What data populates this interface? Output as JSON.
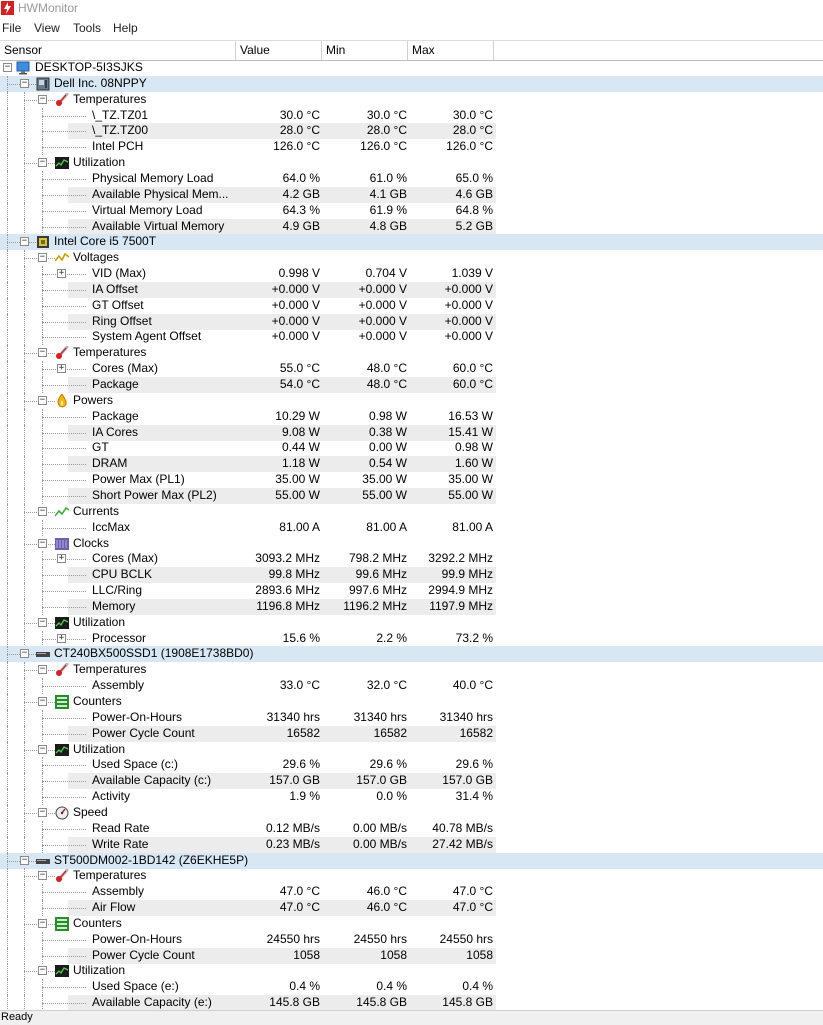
{
  "app": {
    "title": "HWMonitor"
  },
  "menu": [
    "File",
    "View",
    "Tools",
    "Help"
  ],
  "columns": [
    "Sensor",
    "Value",
    "Min",
    "Max"
  ],
  "status": "Ready",
  "rows": [
    {
      "level": 0,
      "type": "root",
      "icon": "computer-icon",
      "label": "DESKTOP-5I3SJKS"
    },
    {
      "level": 1,
      "type": "device",
      "icon": "motherboard-icon",
      "label": "Dell Inc. 08NPPY",
      "hl": true
    },
    {
      "level": 2,
      "type": "group",
      "icon": "thermometer-icon",
      "label": "Temperatures"
    },
    {
      "level": 3,
      "type": "sensor",
      "label": "\\_TZ.TZ01",
      "value": "30.0 °C",
      "min": "30.0 °C",
      "max": "30.0 °C"
    },
    {
      "level": 3,
      "type": "sensor",
      "label": "\\_TZ.TZ00",
      "value": "28.0 °C",
      "min": "28.0 °C",
      "max": "28.0 °C"
    },
    {
      "level": 3,
      "type": "sensor",
      "label": "Intel PCH",
      "value": "126.0 °C",
      "min": "126.0 °C",
      "max": "126.0 °C"
    },
    {
      "level": 2,
      "type": "group",
      "icon": "utilization-icon",
      "label": "Utilization"
    },
    {
      "level": 3,
      "type": "sensor",
      "label": "Physical Memory Load",
      "value": "64.0 %",
      "min": "61.0 %",
      "max": "65.0 %"
    },
    {
      "level": 3,
      "type": "sensor",
      "label": "Available Physical Mem...",
      "value": "4.2 GB",
      "min": "4.1 GB",
      "max": "4.6 GB"
    },
    {
      "level": 3,
      "type": "sensor",
      "label": "Virtual Memory Load",
      "value": "64.3 %",
      "min": "61.9 %",
      "max": "64.8 %"
    },
    {
      "level": 3,
      "type": "sensor",
      "label": "Available Virtual Memory",
      "value": "4.9 GB",
      "min": "4.8 GB",
      "max": "5.2 GB"
    },
    {
      "level": 1,
      "type": "device",
      "icon": "cpu-icon",
      "label": "Intel Core i5 7500T",
      "hl": true
    },
    {
      "level": 2,
      "type": "group",
      "icon": "voltage-icon",
      "label": "Voltages"
    },
    {
      "level": 3,
      "type": "sensor",
      "label": "VID (Max)",
      "value": "0.998 V",
      "min": "0.704 V",
      "max": "1.039 V",
      "exp": true
    },
    {
      "level": 3,
      "type": "sensor",
      "label": "IA Offset",
      "value": "+0.000 V",
      "min": "+0.000 V",
      "max": "+0.000 V"
    },
    {
      "level": 3,
      "type": "sensor",
      "label": "GT Offset",
      "value": "+0.000 V",
      "min": "+0.000 V",
      "max": "+0.000 V"
    },
    {
      "level": 3,
      "type": "sensor",
      "label": "Ring Offset",
      "value": "+0.000 V",
      "min": "+0.000 V",
      "max": "+0.000 V"
    },
    {
      "level": 3,
      "type": "sensor",
      "label": "System Agent Offset",
      "value": "+0.000 V",
      "min": "+0.000 V",
      "max": "+0.000 V"
    },
    {
      "level": 2,
      "type": "group",
      "icon": "thermometer-icon",
      "label": "Temperatures"
    },
    {
      "level": 3,
      "type": "sensor",
      "label": "Cores (Max)",
      "value": "55.0 °C",
      "min": "48.0 °C",
      "max": "60.0 °C",
      "exp": true
    },
    {
      "level": 3,
      "type": "sensor",
      "label": "Package",
      "value": "54.0 °C",
      "min": "48.0 °C",
      "max": "60.0 °C"
    },
    {
      "level": 2,
      "type": "group",
      "icon": "power-icon",
      "label": "Powers"
    },
    {
      "level": 3,
      "type": "sensor",
      "label": "Package",
      "value": "10.29 W",
      "min": "0.98 W",
      "max": "16.53 W"
    },
    {
      "level": 3,
      "type": "sensor",
      "label": "IA Cores",
      "value": "9.08 W",
      "min": "0.38 W",
      "max": "15.41 W"
    },
    {
      "level": 3,
      "type": "sensor",
      "label": "GT",
      "value": "0.44 W",
      "min": "0.00 W",
      "max": "0.98 W"
    },
    {
      "level": 3,
      "type": "sensor",
      "label": "DRAM",
      "value": "1.18 W",
      "min": "0.54 W",
      "max": "1.60 W"
    },
    {
      "level": 3,
      "type": "sensor",
      "label": "Power Max (PL1)",
      "value": "35.00 W",
      "min": "35.00 W",
      "max": "35.00 W"
    },
    {
      "level": 3,
      "type": "sensor",
      "label": "Short Power Max (PL2)",
      "value": "55.00 W",
      "min": "55.00 W",
      "max": "55.00 W"
    },
    {
      "level": 2,
      "type": "group",
      "icon": "current-icon",
      "label": "Currents"
    },
    {
      "level": 3,
      "type": "sensor",
      "label": "IccMax",
      "value": "81.00 A",
      "min": "81.00 A",
      "max": "81.00 A"
    },
    {
      "level": 2,
      "type": "group",
      "icon": "clock-icon",
      "label": "Clocks"
    },
    {
      "level": 3,
      "type": "sensor",
      "label": "Cores (Max)",
      "value": "3093.2 MHz",
      "min": "798.2 MHz",
      "max": "3292.2 MHz",
      "exp": true
    },
    {
      "level": 3,
      "type": "sensor",
      "label": "CPU BCLK",
      "value": "99.8 MHz",
      "min": "99.6 MHz",
      "max": "99.9 MHz"
    },
    {
      "level": 3,
      "type": "sensor",
      "label": "LLC/Ring",
      "value": "2893.6 MHz",
      "min": "997.6 MHz",
      "max": "2994.9 MHz"
    },
    {
      "level": 3,
      "type": "sensor",
      "label": "Memory",
      "value": "1196.8 MHz",
      "min": "1196.2 MHz",
      "max": "1197.9 MHz"
    },
    {
      "level": 2,
      "type": "group",
      "icon": "utilization-icon",
      "label": "Utilization"
    },
    {
      "level": 3,
      "type": "sensor",
      "label": "Processor",
      "value": "15.6 %",
      "min": "2.2 %",
      "max": "73.2 %",
      "exp": true
    },
    {
      "level": 1,
      "type": "device",
      "icon": "drive-icon",
      "label": "CT240BX500SSD1 (1908E1738BD0)",
      "hl": true
    },
    {
      "level": 2,
      "type": "group",
      "icon": "thermometer-icon",
      "label": "Temperatures"
    },
    {
      "level": 3,
      "type": "sensor",
      "label": "Assembly",
      "value": "33.0 °C",
      "min": "32.0 °C",
      "max": "40.0 °C"
    },
    {
      "level": 2,
      "type": "group",
      "icon": "counter-icon",
      "label": "Counters"
    },
    {
      "level": 3,
      "type": "sensor",
      "label": "Power-On-Hours",
      "value": "31340 hrs",
      "min": "31340 hrs",
      "max": "31340 hrs"
    },
    {
      "level": 3,
      "type": "sensor",
      "label": "Power Cycle Count",
      "value": "16582",
      "min": "16582",
      "max": "16582"
    },
    {
      "level": 2,
      "type": "group",
      "icon": "utilization-icon",
      "label": "Utilization"
    },
    {
      "level": 3,
      "type": "sensor",
      "label": "Used Space (c:)",
      "value": "29.6 %",
      "min": "29.6 %",
      "max": "29.6 %"
    },
    {
      "level": 3,
      "type": "sensor",
      "label": "Available Capacity (c:)",
      "value": "157.0 GB",
      "min": "157.0 GB",
      "max": "157.0 GB"
    },
    {
      "level": 3,
      "type": "sensor",
      "label": "Activity",
      "value": "1.9 %",
      "min": "0.0 %",
      "max": "31.4 %"
    },
    {
      "level": 2,
      "type": "group",
      "icon": "speed-icon",
      "label": "Speed"
    },
    {
      "level": 3,
      "type": "sensor",
      "label": "Read Rate",
      "value": "0.12 MB/s",
      "min": "0.00 MB/s",
      "max": "40.78 MB/s"
    },
    {
      "level": 3,
      "type": "sensor",
      "label": "Write Rate",
      "value": "0.23 MB/s",
      "min": "0.00 MB/s",
      "max": "27.42 MB/s"
    },
    {
      "level": 1,
      "type": "device",
      "icon": "drive-icon",
      "label": "ST500DM002-1BD142 (Z6EKHE5P)",
      "hl": true
    },
    {
      "level": 2,
      "type": "group",
      "icon": "thermometer-icon",
      "label": "Temperatures"
    },
    {
      "level": 3,
      "type": "sensor",
      "label": "Assembly",
      "value": "47.0 °C",
      "min": "46.0 °C",
      "max": "47.0 °C"
    },
    {
      "level": 3,
      "type": "sensor",
      "label": "Air Flow",
      "value": "47.0 °C",
      "min": "46.0 °C",
      "max": "47.0 °C"
    },
    {
      "level": 2,
      "type": "group",
      "icon": "counter-icon",
      "label": "Counters"
    },
    {
      "level": 3,
      "type": "sensor",
      "label": "Power-On-Hours",
      "value": "24550 hrs",
      "min": "24550 hrs",
      "max": "24550 hrs"
    },
    {
      "level": 3,
      "type": "sensor",
      "label": "Power Cycle Count",
      "value": "1058",
      "min": "1058",
      "max": "1058"
    },
    {
      "level": 2,
      "type": "group",
      "icon": "utilization-icon",
      "label": "Utilization"
    },
    {
      "level": 3,
      "type": "sensor",
      "label": "Used Space (e:)",
      "value": "0.4 %",
      "min": "0.4 %",
      "max": "0.4 %"
    },
    {
      "level": 3,
      "type": "sensor",
      "label": "Available Capacity (e:)",
      "value": "145.8 GB",
      "min": "145.8 GB",
      "max": "145.8 GB"
    }
  ]
}
